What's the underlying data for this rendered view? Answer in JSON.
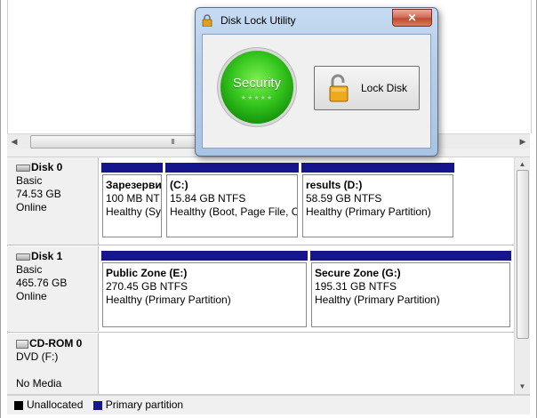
{
  "dialog": {
    "title": "Disk Lock Utility",
    "close_glyph": "✕",
    "badge_label": "Security",
    "badge_stars": "★★★★★",
    "lock_button_label": "Lock Disk"
  },
  "scrollbar": {
    "grip": "III"
  },
  "disks": [
    {
      "name": "Disk 0",
      "type": "Basic",
      "size": "74.53 GB",
      "status": "Online",
      "partitions": [
        {
          "title": "Зарезерви",
          "size": "100 MB NT",
          "status": "Healthy (Sy"
        },
        {
          "title": "(C:)",
          "size": "15.84 GB NTFS",
          "status": "Healthy (Boot, Page File, C"
        },
        {
          "title": "results  (D:)",
          "size": "58.59 GB NTFS",
          "status": "Healthy (Primary Partition)"
        }
      ]
    },
    {
      "name": "Disk 1",
      "type": "Basic",
      "size": "465.76 GB",
      "status": "Online",
      "partitions": [
        {
          "title": "Public Zone  (E:)",
          "size": "270.45 GB NTFS",
          "status": "Healthy (Primary Partition)"
        },
        {
          "title": "Secure Zone  (G:)",
          "size": "195.31 GB NTFS",
          "status": "Healthy (Primary Partition)"
        }
      ]
    },
    {
      "name": "CD-ROM 0",
      "type": "DVD (F:)",
      "status": "No Media"
    }
  ],
  "legend": [
    {
      "label": "Unallocated",
      "color": "#000000"
    },
    {
      "label": "Primary partition",
      "color": "#16168c"
    }
  ]
}
